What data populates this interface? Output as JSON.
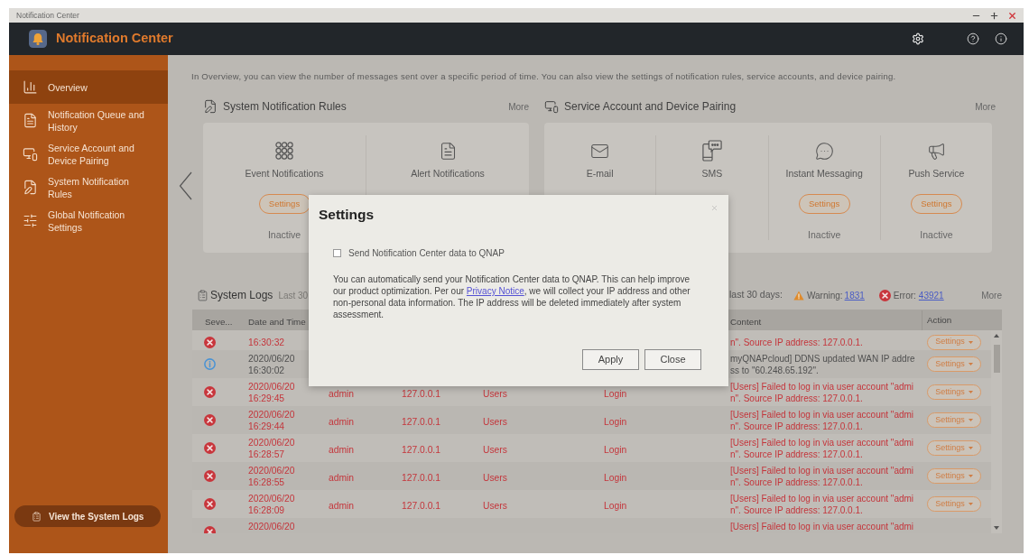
{
  "window": {
    "title": "Notification Center"
  },
  "app": {
    "title": "Notification Center"
  },
  "sidebar": {
    "items": [
      {
        "label": "Overview",
        "selected": true
      },
      {
        "label": "Notification Queue and History",
        "selected": false
      },
      {
        "label": "Service Account and Device Pairing",
        "selected": false
      },
      {
        "label": "System Notification Rules",
        "selected": false
      },
      {
        "label": "Global Notification Settings",
        "selected": false
      }
    ],
    "footer_button": "View the System Logs"
  },
  "overview": {
    "intro": "In Overview, you can view the number of messages sent over a specific period of time. You can also view the settings of notification rules, service accounts, and device pairing.",
    "sections": [
      {
        "title": "System Notification Rules",
        "more": "More",
        "items": [
          {
            "label": "Event Notifications",
            "button": "Settings",
            "status": "Inactive"
          },
          {
            "label": "Alert Notifications"
          }
        ]
      },
      {
        "title": "Service Account and Device Pairing",
        "more": "More",
        "items": [
          {
            "label": "E-mail"
          },
          {
            "label": "SMS"
          },
          {
            "label": "Instant Messaging",
            "button": "Settings",
            "status": "Inactive"
          },
          {
            "label": "Push Service",
            "button": "Settings",
            "status": "Inactive"
          }
        ]
      }
    ]
  },
  "system_logs": {
    "title": "System Logs",
    "range_left": "Last 30",
    "range_right": "last 30 days:",
    "warning": {
      "label": "Warning:",
      "count": "1831"
    },
    "error": {
      "label": "Error:",
      "count": "43921"
    },
    "more": "More",
    "table": {
      "columns": {
        "severity": "Seve...",
        "date_time": "Date and Time",
        "content": "Content",
        "action": "Action"
      },
      "rows": [
        {
          "kind": "error",
          "date_time": [
            "16:30:32"
          ],
          "content": [
            "n\". Source IP address: 127.0.0.1."
          ],
          "action": "Settings"
        },
        {
          "kind": "info",
          "date_time": [
            "2020/06/20",
            "16:30:02"
          ],
          "content": [
            "myQNAPcloud] DDNS updated WAN IP addre",
            "ss to \"60.248.65.192\"."
          ],
          "action": "Settings"
        },
        {
          "kind": "error",
          "date_time": [
            "2020/06/20",
            "16:29:45"
          ],
          "user": "admin",
          "ip": "127.0.0.1",
          "category": "Users",
          "application": "Login",
          "content": [
            "[Users] Failed to log in via user account \"admi",
            "n\". Source IP address: 127.0.0.1."
          ],
          "action": "Settings"
        },
        {
          "kind": "error",
          "date_time": [
            "2020/06/20",
            "16:29:44"
          ],
          "user": "admin",
          "ip": "127.0.0.1",
          "category": "Users",
          "application": "Login",
          "content": [
            "[Users] Failed to log in via user account \"admi",
            "n\". Source IP address: 127.0.0.1."
          ],
          "action": "Settings"
        },
        {
          "kind": "error",
          "date_time": [
            "2020/06/20",
            "16:28:57"
          ],
          "user": "admin",
          "ip": "127.0.0.1",
          "category": "Users",
          "application": "Login",
          "content": [
            "[Users] Failed to log in via user account \"admi",
            "n\". Source IP address: 127.0.0.1."
          ],
          "action": "Settings"
        },
        {
          "kind": "error",
          "date_time": [
            "2020/06/20",
            "16:28:55"
          ],
          "user": "admin",
          "ip": "127.0.0.1",
          "category": "Users",
          "application": "Login",
          "content": [
            "[Users] Failed to log in via user account \"admi",
            "n\". Source IP address: 127.0.0.1."
          ],
          "action": "Settings"
        },
        {
          "kind": "error",
          "date_time": [
            "2020/06/20",
            "16:28:09"
          ],
          "user": "admin",
          "ip": "127.0.0.1",
          "category": "Users",
          "application": "Login",
          "content": [
            "[Users] Failed to log in via user account \"admi",
            "n\". Source IP address: 127.0.0.1."
          ],
          "action": "Settings"
        },
        {
          "kind": "error",
          "date_time": [
            "2020/06/20"
          ],
          "content": [
            "[Users] Failed to log in via user account \"admi"
          ]
        }
      ]
    }
  },
  "dialog": {
    "title": "Settings",
    "checkbox": {
      "label": "Send Notification Center data to QNAP",
      "checked": false
    },
    "description": {
      "before": "You can automatically send your Notification Center data to QNAP. This can help improve our product optimization. Per our ",
      "link": "Privacy Notice",
      "after": ", we will collect your IP address and other non-personal data information. The IP address will be deleted immediately after system assessment."
    },
    "buttons": [
      "Apply",
      "Close"
    ]
  }
}
